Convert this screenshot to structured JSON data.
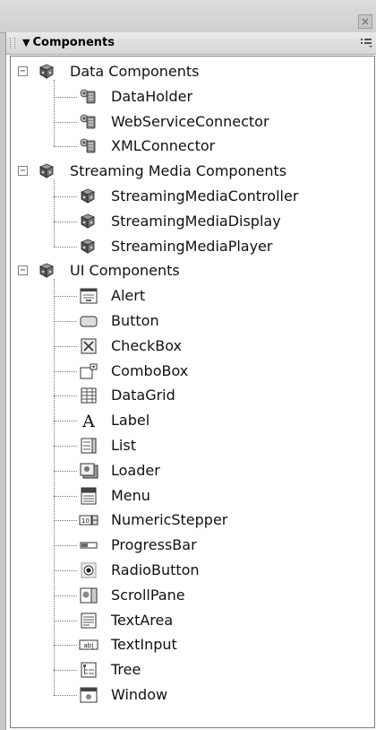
{
  "panel": {
    "title": "Components"
  },
  "tree": [
    {
      "label": "Data Components",
      "expanded": true,
      "toggle": "−",
      "icon": "cube-icon",
      "items": [
        {
          "label": "DataHolder",
          "icon": "data-component-icon"
        },
        {
          "label": "WebServiceConnector",
          "icon": "data-component-icon"
        },
        {
          "label": "XMLConnector",
          "icon": "data-component-icon"
        }
      ]
    },
    {
      "label": "Streaming Media Components",
      "expanded": true,
      "toggle": "−",
      "icon": "cube-icon",
      "items": [
        {
          "label": "StreamingMediaController",
          "icon": "cube-icon"
        },
        {
          "label": "StreamingMediaDisplay",
          "icon": "cube-icon"
        },
        {
          "label": "StreamingMediaPlayer",
          "icon": "cube-icon"
        }
      ]
    },
    {
      "label": "UI Components",
      "expanded": true,
      "toggle": "−",
      "icon": "cube-icon",
      "items": [
        {
          "label": "Alert",
          "icon": "alert-icon"
        },
        {
          "label": "Button",
          "icon": "button-icon"
        },
        {
          "label": "CheckBox",
          "icon": "checkbox-icon"
        },
        {
          "label": "ComboBox",
          "icon": "combobox-icon"
        },
        {
          "label": "DataGrid",
          "icon": "datagrid-icon"
        },
        {
          "label": "Label",
          "icon": "label-icon"
        },
        {
          "label": "List",
          "icon": "list-icon"
        },
        {
          "label": "Loader",
          "icon": "loader-icon"
        },
        {
          "label": "Menu",
          "icon": "menu-icon"
        },
        {
          "label": "NumericStepper",
          "icon": "numeric-stepper-icon"
        },
        {
          "label": "ProgressBar",
          "icon": "progressbar-icon"
        },
        {
          "label": "RadioButton",
          "icon": "radiobutton-icon"
        },
        {
          "label": "ScrollPane",
          "icon": "scrollpane-icon"
        },
        {
          "label": "TextArea",
          "icon": "textarea-icon"
        },
        {
          "label": "TextInput",
          "icon": "textinput-icon"
        },
        {
          "label": "Tree",
          "icon": "tree-icon"
        },
        {
          "label": "Window",
          "icon": "window-icon"
        }
      ]
    }
  ]
}
